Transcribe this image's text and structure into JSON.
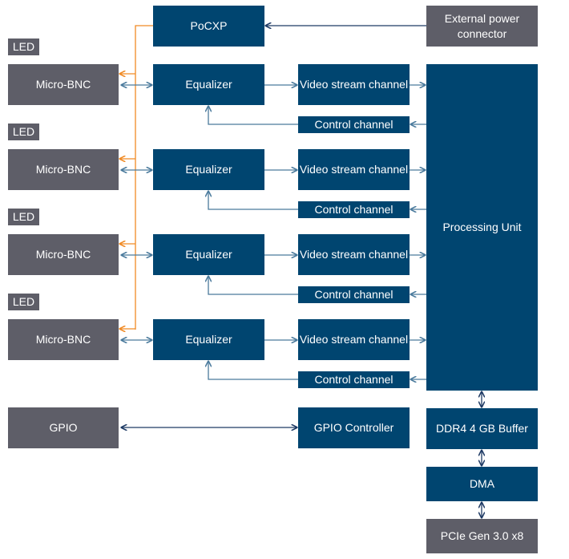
{
  "colors": {
    "block_blue": "#004570",
    "block_gray": "#5e5e68",
    "link_blue": "#4a7a9c",
    "link_dark": "#1e3a64",
    "power_orange": "#f08a24"
  },
  "external": {
    "power_connector": "External power connector",
    "gpio": "GPIO",
    "pcie": "PCIe Gen 3.0 x8"
  },
  "poCXP": "PoCXP",
  "channels": [
    {
      "led": "LED",
      "connector": "Micro-BNC",
      "equalizer": "Equalizer",
      "video": "Video stream channel",
      "control": "Control channel"
    },
    {
      "led": "LED",
      "connector": "Micro-BNC",
      "equalizer": "Equalizer",
      "video": "Video stream channel",
      "control": "Control channel"
    },
    {
      "led": "LED",
      "connector": "Micro-BNC",
      "equalizer": "Equalizer",
      "video": "Video stream channel",
      "control": "Control channel"
    },
    {
      "led": "LED",
      "connector": "Micro-BNC",
      "equalizer": "Equalizer",
      "video": "Video stream channel",
      "control": "Control channel"
    }
  ],
  "processing_unit": "Processing Unit",
  "gpio_controller": "GPIO Controller",
  "ddr_buffer": "DDR4 4 GB Buffer",
  "dma": "DMA"
}
